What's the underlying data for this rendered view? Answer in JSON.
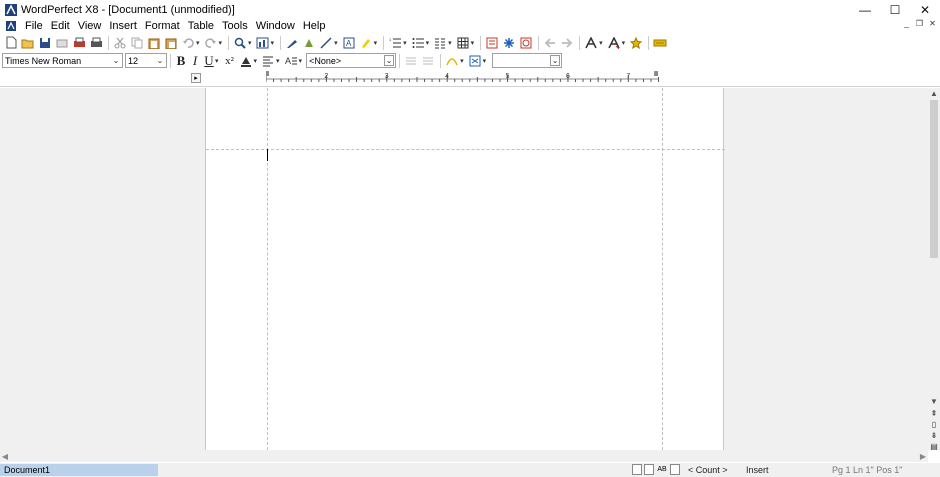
{
  "window": {
    "title": "WordPerfect X8 - [Document1 (unmodified)]",
    "controls": {
      "minimize": "—",
      "maximize": "☐",
      "close": "✕"
    }
  },
  "menu": {
    "items": [
      "File",
      "Edit",
      "View",
      "Insert",
      "Format",
      "Table",
      "Tools",
      "Window",
      "Help"
    ],
    "mdi": {
      "minimize": "_",
      "restore": "❐",
      "close": "✕"
    }
  },
  "property_bar": {
    "font_name": "Times New Roman",
    "font_size": "12",
    "bold": "B",
    "italic": "I",
    "underline": "U",
    "superscript": "x²",
    "style": "<None>",
    "zoom": ""
  },
  "ruler": {
    "labels": [
      "1",
      "2",
      "3",
      "4",
      "5",
      "6",
      "7"
    ]
  },
  "statusbar": {
    "document_tab": "Document1",
    "count": "< Count >",
    "mode": "Insert",
    "position": "Pg 1 Ln 1\" Pos 1\"",
    "icon_labels": [
      "AB"
    ]
  },
  "colors": {
    "accent": "#1f5fbf",
    "doc_tab": "#b9d1ea",
    "workspace": "#f0f0f0",
    "gold": "#e6b800",
    "red": "#c0392b"
  }
}
